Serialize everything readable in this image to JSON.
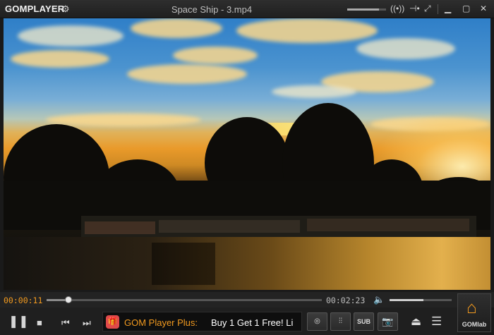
{
  "app": {
    "logo": "GOMPLAYER",
    "window_title": "Space Ship - 3.mp4"
  },
  "titlebar": {
    "volume_level": 0.82,
    "icons": [
      "settings-gear-icon",
      "volume-slider",
      "audio-waves-icon",
      "pin-icon",
      "minimize-icon",
      "fullscreen-icon",
      "close-icon"
    ]
  },
  "playback": {
    "current_time": "00:00:11",
    "duration": "00:02:23",
    "progress": 0.08,
    "volume": 0.55
  },
  "controls": {
    "buttons": [
      "pause-icon",
      "stop-icon",
      "previous-icon",
      "next-icon"
    ]
  },
  "ad": {
    "brand": "GOM Player Plus:",
    "text": "Buy 1 Get 1 Free! Li"
  },
  "tools": {
    "sub_label": "SUB",
    "gomlab_label": "GOMlab"
  },
  "colors": {
    "accent": "#f29a1f",
    "background": "#1f1f1f"
  }
}
